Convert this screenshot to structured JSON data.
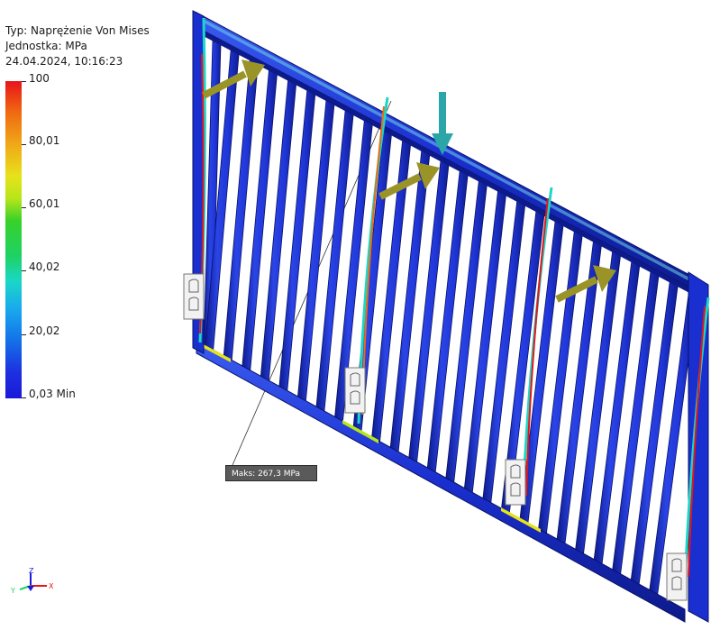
{
  "info": {
    "type_line": "Typ: Naprężenie Von Mises",
    "unit_line": "Jednostka: MPa",
    "date_line": "24.04.2024, 10:16:23"
  },
  "legend": {
    "ticks": [
      "100",
      "80,01",
      "60,01",
      "40,02",
      "20,02",
      "0,03 Min"
    ]
  },
  "max_label": "Maks: 267,3 MPa",
  "axes": {
    "x": "X",
    "y": "Y",
    "z": "Z"
  },
  "colors": {
    "frame_blue": "#1f33d6",
    "frame_dark": "#0d1a8a",
    "arrow_olive": "#9a9428",
    "arrow_teal": "#2aa6a8"
  }
}
